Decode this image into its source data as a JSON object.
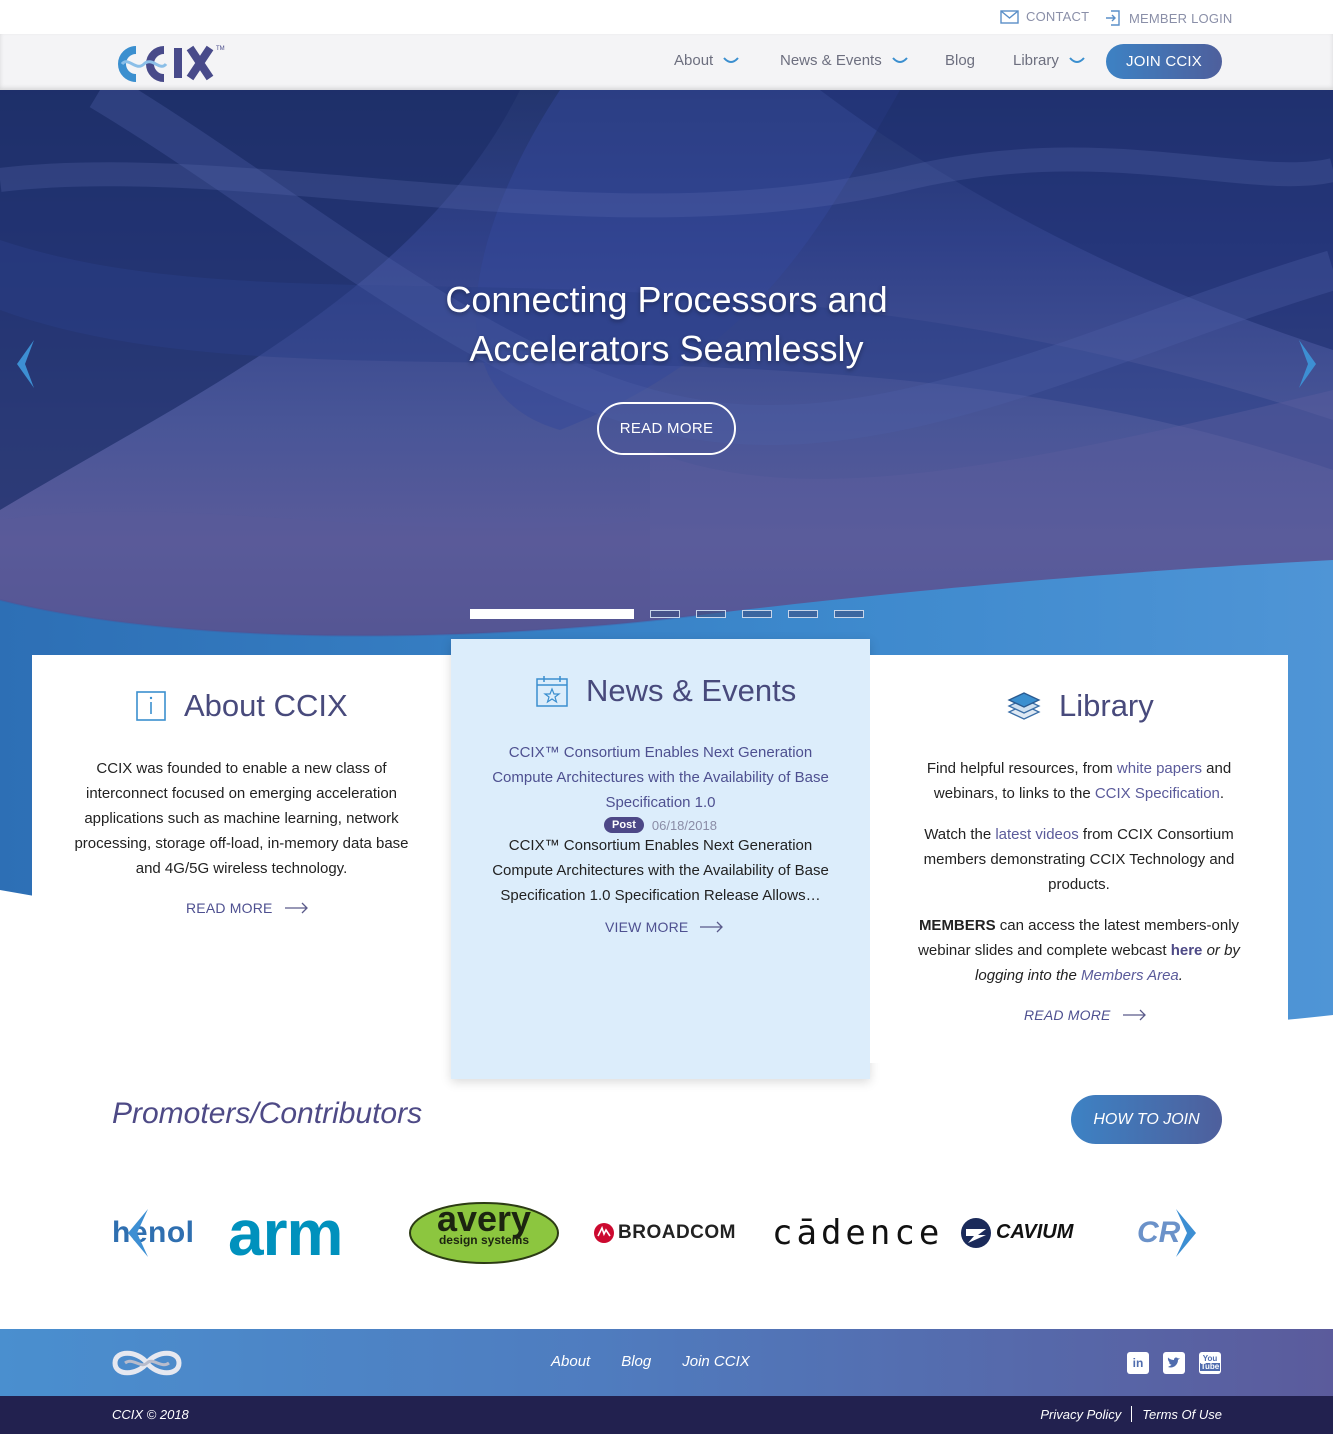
{
  "topbar": {
    "contact_label": "CONTACT",
    "member_login_label": "MEMBER LOGIN"
  },
  "nav": {
    "logo_text": "CCIX",
    "items": [
      {
        "label": "About",
        "has_dropdown": true
      },
      {
        "label": "News & Events",
        "has_dropdown": true
      },
      {
        "label": "Blog",
        "has_dropdown": false
      },
      {
        "label": "Library",
        "has_dropdown": true
      }
    ],
    "join_label": "JOIN CCIX"
  },
  "hero": {
    "title_line1": "Connecting Processors and",
    "title_line2": "Accelerators Seamlessly",
    "button_label": "READ MORE",
    "slide_count": 6,
    "active_slide": 1
  },
  "about": {
    "title": "About CCIX",
    "body": "CCIX was founded to enable a new class of interconnect focused on emerging acceleration applications such as machine learning, network processing, storage off-load, in-memory data base and 4G/5G wireless technology.",
    "readmore_label": "READ MORE"
  },
  "news": {
    "title": "News & Events",
    "post_title": "CCIX™ Consortium Enables Next Generation Compute Architectures with the Availability of Base Specification 1.0",
    "badge": "Post",
    "date": "06/18/2018",
    "excerpt": "CCIX™ Consortium Enables Next Generation Compute Architectures with the Availability of Base Specification 1.0 Specification Release Allows…",
    "viewmore_label": "VIEW MORE"
  },
  "library": {
    "title": "Library",
    "p1_before": "Find helpful resources, from ",
    "p1_link1": "white papers",
    "p1_mid": " and webinars, to links to the ",
    "p1_link2": "CCIX Specification",
    "p1_after": ".",
    "p2_before": "Watch the ",
    "p2_link": "latest videos",
    "p2_after": " from CCIX Consortium members demonstrating CCIX Technology and products.",
    "p3_strong": "MEMBERS",
    "p3_text": " can access the latest members-only webinar slides and complete webcast ",
    "p3_here": "here",
    "p3_italic": " or by logging into the ",
    "p3_link": "Members Area",
    "p3_end": ".",
    "readmore_label": "READ MORE"
  },
  "promoters": {
    "title": "Promoters/Contributors",
    "howto_label": "HOW TO JOIN",
    "logos": [
      {
        "name": "henol",
        "text": "henol"
      },
      {
        "name": "arm",
        "text": "arm"
      },
      {
        "name": "avery",
        "text": "avery",
        "sub": "design systems"
      },
      {
        "name": "broadcom",
        "text": "BROADCOM"
      },
      {
        "name": "cadence",
        "text": "cādence"
      },
      {
        "name": "cavium",
        "text": "CAVIUM"
      },
      {
        "name": "cr",
        "text": "CR"
      }
    ],
    "colors": {
      "arm": "#0091bd",
      "avery_green": "#8cc63f",
      "broadcom_red": "#cc092f",
      "cavium_blue": "#1a2a5a"
    }
  },
  "footer": {
    "links": [
      "About",
      "Blog",
      "Join CCIX"
    ],
    "social": [
      "linkedin-icon",
      "twitter-icon",
      "youtube-icon"
    ],
    "copyright": "CCIX © 2018",
    "privacy": "Privacy Policy",
    "terms": "Terms Of Use"
  }
}
